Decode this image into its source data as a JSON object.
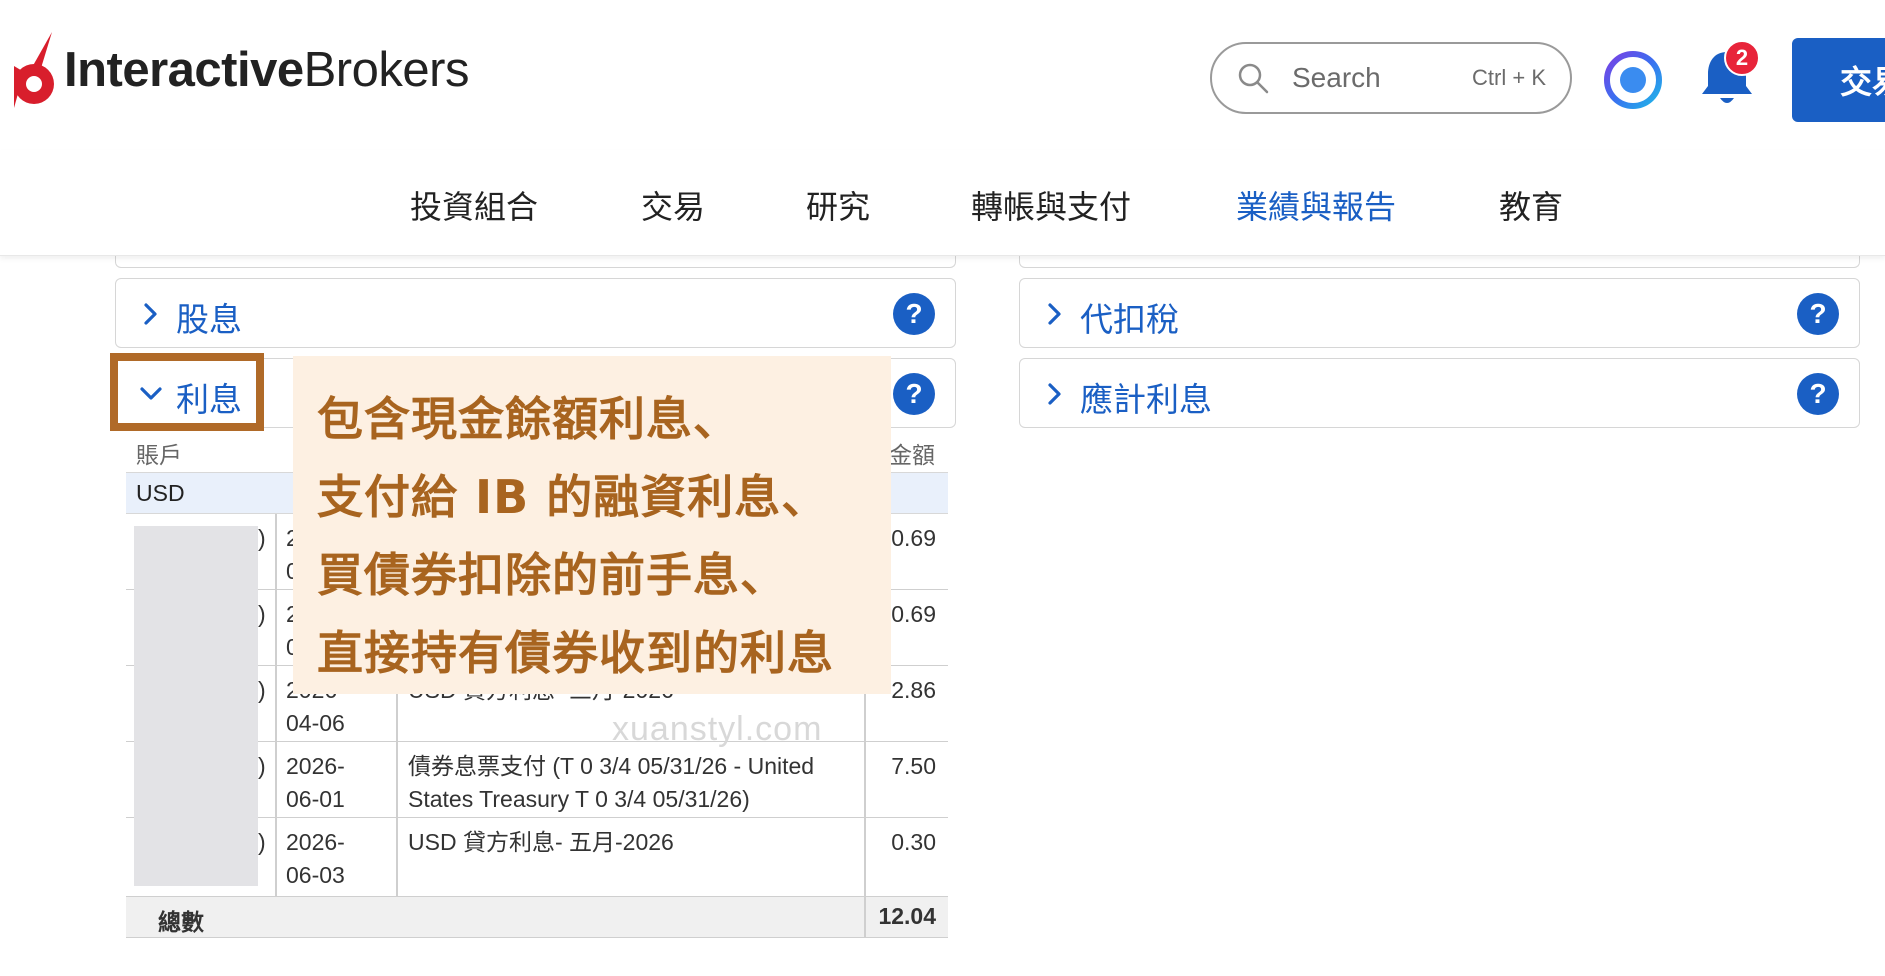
{
  "header": {
    "logo_bold": "Interactive",
    "logo_light": "Brokers",
    "search_placeholder": "Search",
    "search_shortcut": "Ctrl + K",
    "notification_count": "2",
    "trade_button": "交易"
  },
  "nav": {
    "items": [
      "投資組合",
      "交易",
      "研究",
      "轉帳與支付",
      "業績與報告",
      "教育"
    ],
    "active": "業績與報告"
  },
  "panels": {
    "dividends": "股息",
    "interest": "利息",
    "withholding": "代扣稅",
    "accrued_interest": "應計利息",
    "help_glyph": "?"
  },
  "table": {
    "headers": {
      "account": "賬戶",
      "amount": "金額"
    },
    "currency": "USD",
    "rows": [
      {
        "date_l1": "2",
        "date_l2": "0",
        "description": "",
        "amount": "0.69"
      },
      {
        "date_l1": "2",
        "date_l2": "0",
        "description": "",
        "amount": "0.69"
      },
      {
        "date_l1": "2026-",
        "date_l2": "04-06",
        "description": "USD 貸方利息- 三月-2026",
        "amount": "2.86"
      },
      {
        "date_l1": "2026-",
        "date_l2": "06-01",
        "description_l1": "債券息票支付 (T 0 3/4 05/31/26 - United",
        "description_l2": "States Treasury T 0 3/4 05/31/26)",
        "amount": "7.50"
      },
      {
        "date_l1": "2026-",
        "date_l2": "06-03",
        "description": "USD 貸方利息- 五月-2026",
        "amount": "0.30"
      }
    ],
    "total_label": "總數",
    "total_value": "12.04"
  },
  "watermark": "xuanstyl.com",
  "callout": {
    "lines": [
      "包含現金餘額利息、",
      "支付給 IB 的融資利息、",
      "買債券扣除的前手息、",
      "直接持有債券收到的利息"
    ]
  },
  "colors": {
    "brand_blue": "#1a5fc4",
    "logo_red": "#d81e2c",
    "highlight_brown": "#b06a28",
    "callout_bg": "#fdf0e2",
    "callout_text": "#a8641f"
  }
}
